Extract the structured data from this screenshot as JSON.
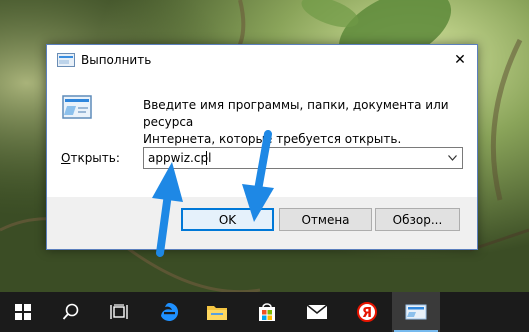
{
  "window": {
    "title": "Выполнить",
    "close_glyph": "✕",
    "description_line1": "Введите имя программы, папки, документа или ресурса",
    "description_line2": "Интернета, которые требуется открыть.",
    "open_label_prefix": "",
    "open_label_accel": "О",
    "open_label_rest": "ткрыть:",
    "input_value": "appwiz.cpl",
    "buttons": {
      "ok": "OK",
      "cancel": "Отмена",
      "browse": "Обзор..."
    },
    "icon": "run-icon"
  },
  "taskbar": {
    "items": [
      "windows-start-icon",
      "search-icon",
      "task-view-icon",
      "edge-icon",
      "file-explorer-icon",
      "store-icon",
      "mail-icon",
      "yandex-browser-icon",
      "run-app-icon"
    ],
    "yandex_letter": "Я"
  },
  "colors": {
    "accent": "#0078d7",
    "arrow": "#1e88e5",
    "taskbar": "#1b1b1b"
  }
}
